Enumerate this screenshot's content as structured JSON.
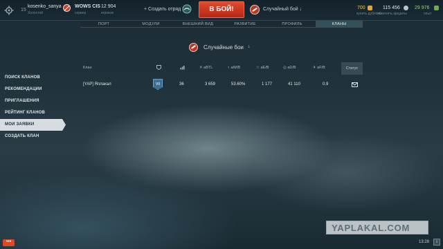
{
  "header": {
    "level": "15",
    "username": "kosenko_sanya",
    "user_status": "Холостой",
    "server": "WOWS CIS",
    "server_sub": "сервер",
    "online": "12 904",
    "online_sub": "игроков",
    "squad_label": "Создать отряд",
    "battle_label": "В БОЙ!",
    "mode_label": "Случайный бой",
    "doubloons": "700",
    "doubloons_sub": "купить дублоны",
    "credits": "115 456",
    "credits_sub": "обменять кредиты",
    "free_xp": "29 976",
    "free_xp_sub": "опыт"
  },
  "tabs": [
    "ПОРТ",
    "МОДУЛИ",
    "ВНЕШНИЙ ВИД",
    "РАЗВИТИЕ",
    "ПРОФИЛЬ",
    "КЛАНЫ"
  ],
  "active_tab": "КЛАНЫ",
  "main": {
    "title": "Случайные бои",
    "title_arrow": "↓"
  },
  "table": {
    "headers": {
      "clan": "Клан",
      "tier": "",
      "battles": "",
      "abtl": "aBTL",
      "awb": "aW/B",
      "aeb": "aE/B",
      "adb": "aD/B",
      "afb": "aF/B",
      "status": "Статус"
    },
    "rows": [
      {
        "clan": "[YAP] Яплакал",
        "tier": "VII",
        "battles": "36",
        "abtl": "3 659",
        "awb": "53.60%",
        "aeb": "1 177",
        "adb": "41 110",
        "afb": "0.9"
      }
    ]
  },
  "sidebar": {
    "items": [
      {
        "label": "ПОИСК КЛАНОВ"
      },
      {
        "label": "РЕКОМЕНДАЦИИ"
      },
      {
        "label": "ПРИГЛАШЕНИЯ"
      },
      {
        "label": "РЕЙТИНГ КЛАНОВ"
      },
      {
        "label": "МОИ ЗАЯВКИ"
      },
      {
        "label": "СОЗДАТЬ КЛАН"
      }
    ],
    "active_index": 4
  },
  "footer": {
    "chat_label": "•••",
    "watermark": "YAPLAKAL.COM",
    "clock": "13:28",
    "info_label": "i"
  },
  "colors": {
    "battle_button": "#d13a22",
    "active_tab": "#33505b",
    "sidebar_active": "#d6dde0",
    "doubloons": "#f2c36b",
    "credits": "#dfe6e9",
    "free_xp": "#9fd27a"
  }
}
